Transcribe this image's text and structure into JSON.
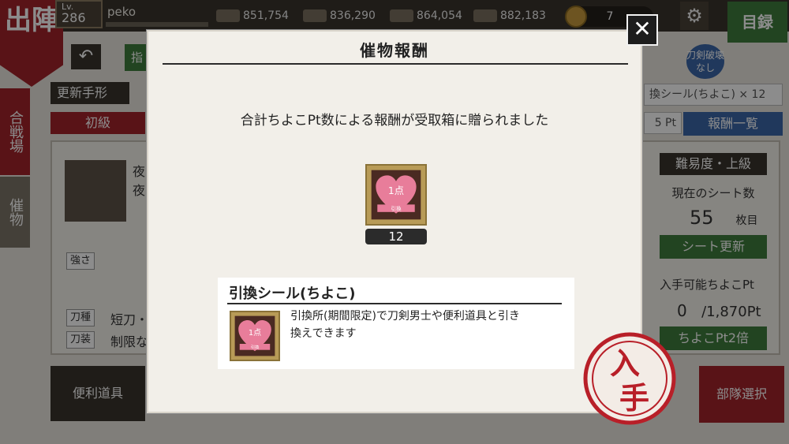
{
  "header": {
    "sortie_label": "出陣",
    "level_prefix": "Lv.",
    "level": "286",
    "username": "peko",
    "resources": [
      "851,754",
      "836,290",
      "864,054",
      "882,183"
    ],
    "koban": "7",
    "catalog_label": "目録"
  },
  "background": {
    "left_nav_1": "合戦場",
    "left_nav_2": "催物",
    "update_label": "更新手形",
    "difficulty_tab": "初級",
    "green_stub": "指",
    "event_text_1": "夜",
    "event_text_2": "夜",
    "strength_label": "強さ",
    "sword_type_label": "刀種",
    "sword_type_value": "短刀・",
    "sword_equip_label": "刀装",
    "sword_equip_value": "制限な",
    "tools_label": "便利道具",
    "no_break_stamp": "刀剣破壊なし",
    "seal_bar": "換シール(ちよこ) × 12",
    "pt_box": "5 Pt",
    "reward_list_btn": "報酬一覧",
    "difficulty_label": "難易度・上級",
    "current_sheet_label": "現在のシート数",
    "current_sheet_count": "55",
    "current_sheet_unit": "枚目",
    "sheet_update_btn": "シート更新",
    "avail_label": "入手可能ちよこPt",
    "avail_value": "0",
    "avail_max": "/1,870Pt",
    "double_btn": "ちよこPt2倍",
    "squad_btn": "部隊選択"
  },
  "modal": {
    "title": "催物報酬",
    "message": "合計ちよこPt数による報酬が受取箱に贈られました",
    "reward_count": "12",
    "heart_text": "1点",
    "heart_band": "引換",
    "item_name": "引換シール(ちよこ)",
    "item_description_1": "引換所(期間限定)で刀剣男士や便利道具と引き",
    "item_description_2": "換えできます",
    "close_label": "✕",
    "acquired_stamp": [
      "入",
      "手"
    ]
  },
  "colors": {
    "accent_red": "#a3242a",
    "accent_green": "#3f7d3c",
    "accent_blue": "#3b67a8",
    "heart_pink": "#e87d9a",
    "stamp_red": "#b81f28"
  },
  "icons": [
    "back-arrow-icon",
    "gear-icon",
    "close-icon",
    "heart-icon",
    "koban-icon",
    "wood-icon",
    "charcoal-icon",
    "steel-icon",
    "whetstone-icon"
  ]
}
